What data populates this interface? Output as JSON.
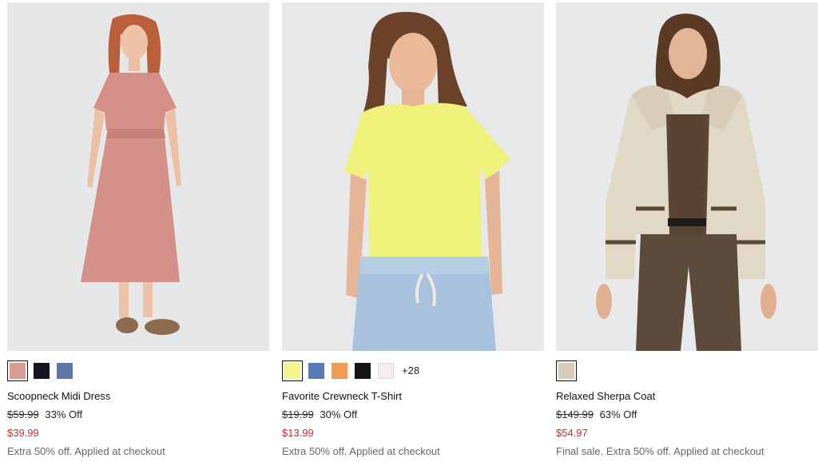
{
  "products": [
    {
      "name": "Scoopneck Midi Dress",
      "original_price": "$59.99",
      "discount": "33% Off",
      "sale_price": "$39.99",
      "promo": "Extra 50% off. Applied at checkout",
      "swatches": [
        "#d99a92",
        "#12151f",
        "#5f77a6"
      ],
      "more": ""
    },
    {
      "name": "Favorite Crewneck T-Shirt",
      "original_price": "$19.99",
      "discount": "30% Off",
      "sale_price": "$13.99",
      "promo": "Extra 50% off. Applied at checkout",
      "swatches": [
        "#f1f58a",
        "#5a79b8",
        "#ef9a55",
        "#151515",
        "#f6ecef"
      ],
      "more": "+28"
    },
    {
      "name": "Relaxed Sherpa Coat",
      "original_price": "$149.99",
      "discount": "63% Off",
      "sale_price": "$54.97",
      "promo": "Final sale. Extra 50% off. Applied at checkout",
      "swatches": [
        "#d6ccbc"
      ],
      "more": ""
    }
  ]
}
